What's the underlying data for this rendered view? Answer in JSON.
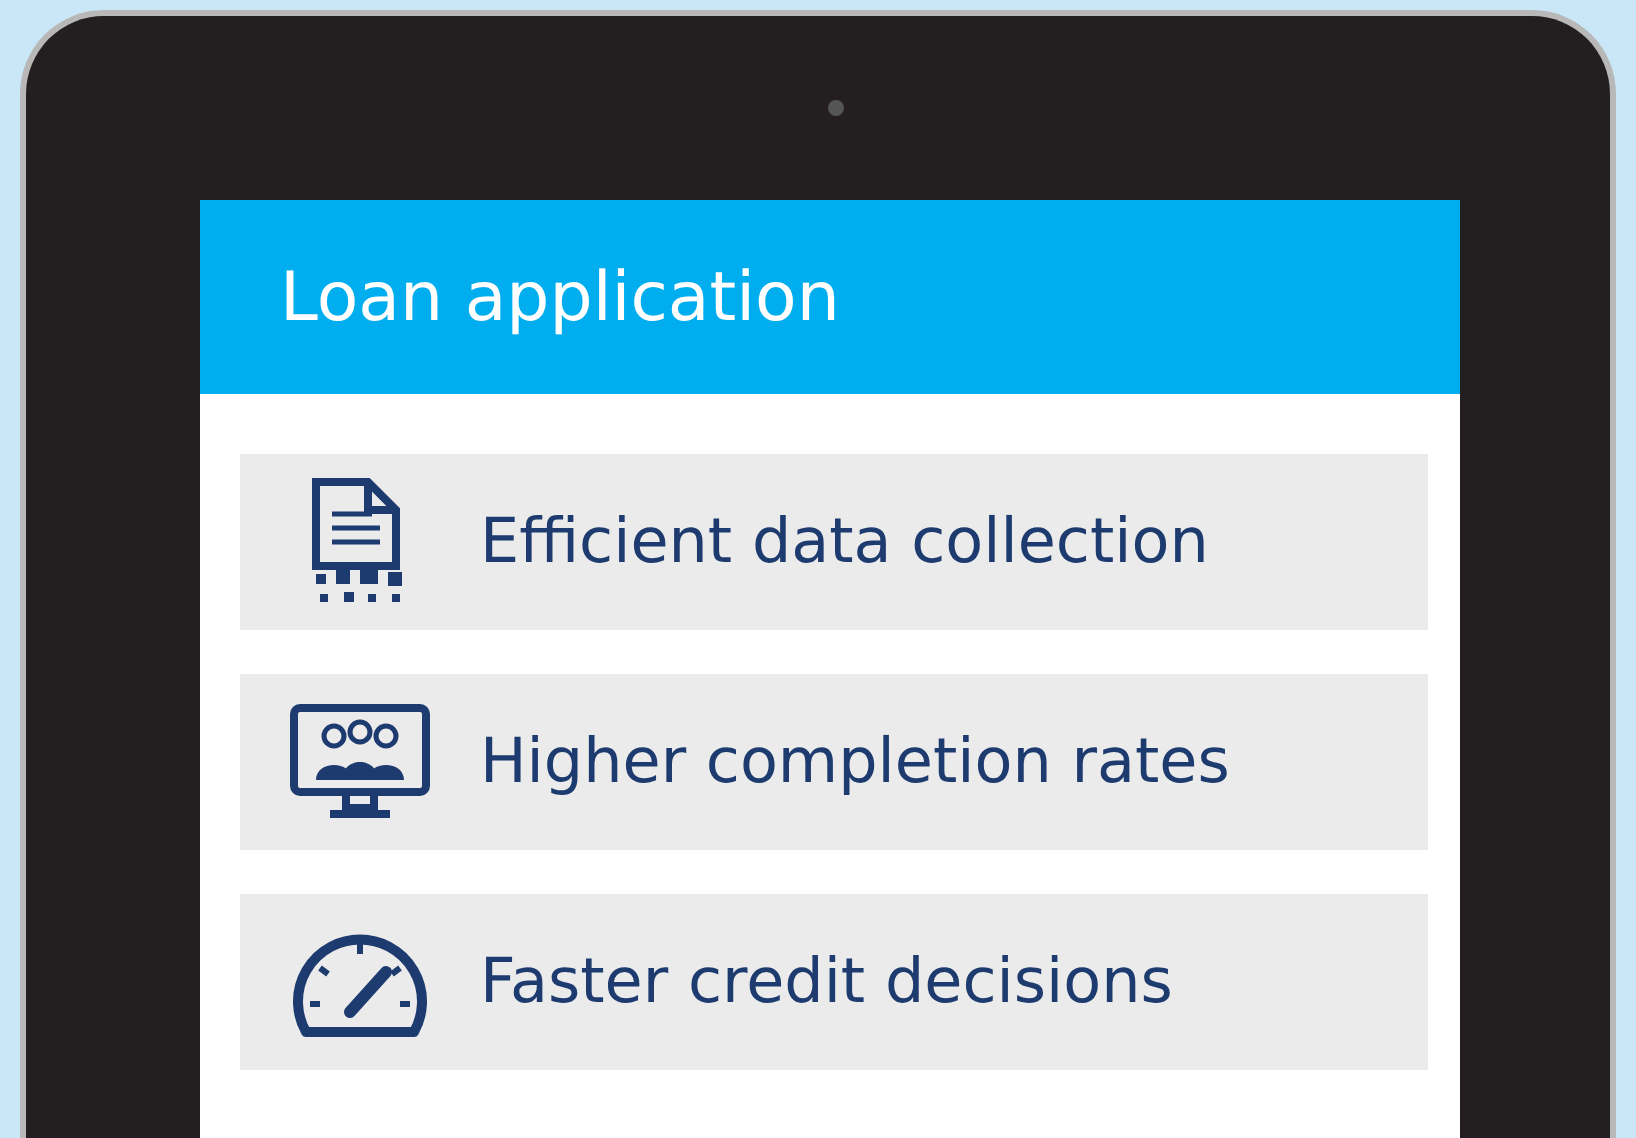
{
  "header": {
    "title": "Loan application"
  },
  "features": [
    {
      "kind": "document",
      "label": "Efficient data collection"
    },
    {
      "kind": "monitor",
      "label": "Higher completion rates"
    },
    {
      "kind": "gauge",
      "label": "Faster credit decisions"
    }
  ]
}
